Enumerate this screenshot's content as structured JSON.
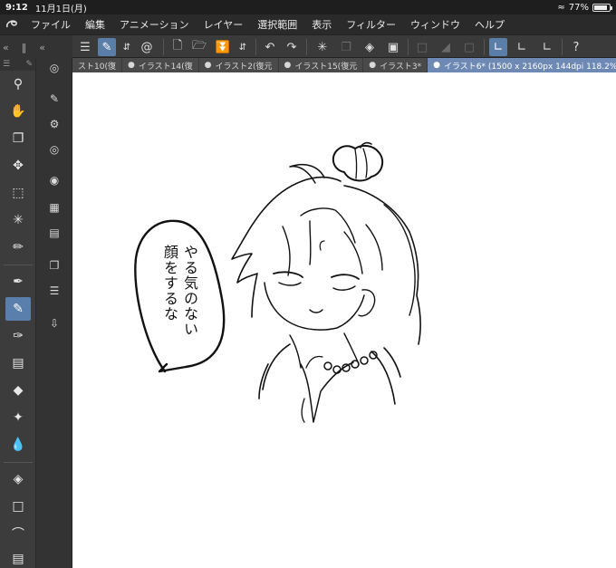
{
  "status": {
    "time": "9:12",
    "date": "11月1日(月)",
    "battery": "77%",
    "battery_level": 0.77
  },
  "menu": {
    "items": [
      "ファイル",
      "編集",
      "アニメーション",
      "レイヤー",
      "選択範囲",
      "表示",
      "フィルター",
      "ウィンドウ",
      "ヘルプ"
    ]
  },
  "tabs": [
    {
      "label": "スト10(復",
      "active": false
    },
    {
      "label": "イラスト14(復",
      "active": false
    },
    {
      "label": "イラスト2(復元",
      "active": false
    },
    {
      "label": "イラスト15(復元",
      "active": false
    },
    {
      "label": "イラスト3*",
      "active": false
    },
    {
      "label": "イラスト6* (1500 x 2160px 144dpi 118.2%)",
      "active": true
    }
  ],
  "canvas": {
    "speech_text": [
      "やる気のない",
      "顔をするな"
    ]
  },
  "icons": {
    "toolbar": [
      "menu-icon",
      "quick-access-icon",
      "up-down-arrows-icon",
      "spiral-icon",
      "new-file-icon",
      "open-folder-icon",
      "save-icon",
      "up-down-arrows-icon",
      "undo-icon",
      "redo-icon",
      "loading-icon",
      "copy-icon",
      "fill-icon",
      "crop-icon",
      "transform-icon",
      "gradient-icon",
      "layer-icon",
      "ruler-active-icon",
      "brush-ruler-icon",
      "angle-ruler-icon",
      "help-icon"
    ],
    "tools": [
      "zoom-icon",
      "hand-icon",
      "object-icon",
      "move-icon",
      "selection-icon",
      "magic-wand-icon",
      "eyedropper-icon",
      "pen-icon",
      "pencil-icon",
      "brush-icon",
      "airbrush-icon",
      "eraser-icon",
      "sparkle-icon",
      "blend-icon",
      "fill-bucket-icon",
      "shape-icon",
      "curve-icon",
      "ruler-icon"
    ]
  },
  "colors": {
    "accent": "#5b7fac",
    "active_tab": "#6d89b4"
  }
}
